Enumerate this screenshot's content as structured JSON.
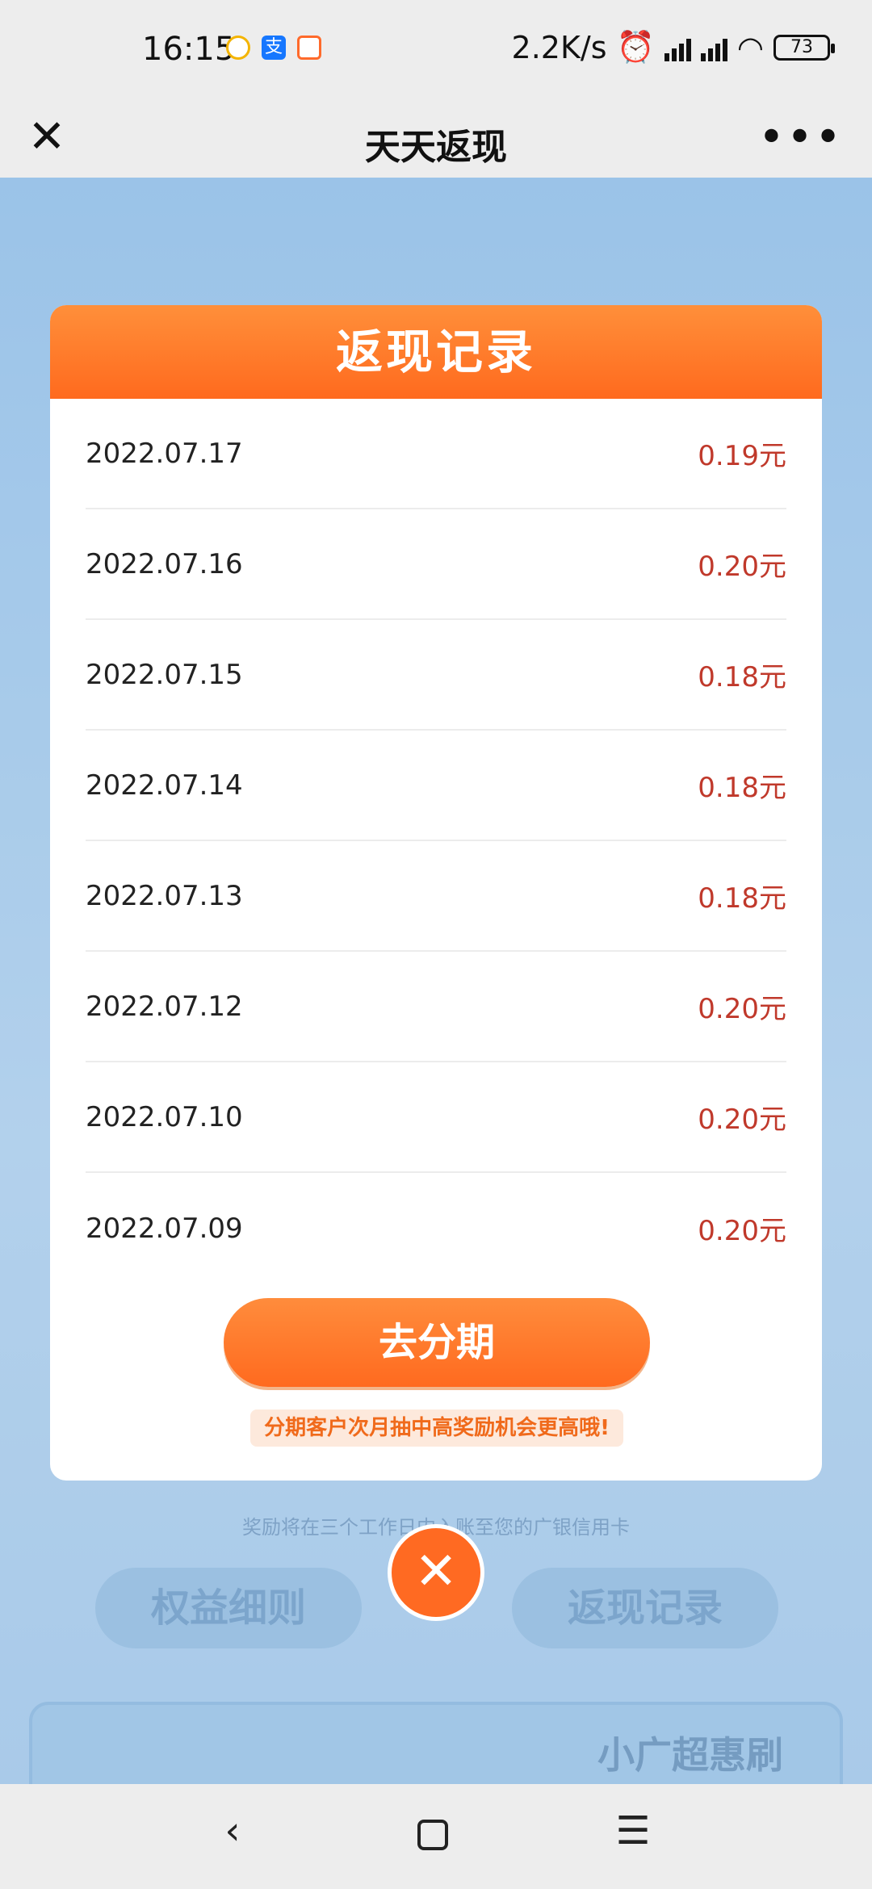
{
  "status_bar": {
    "time": "16:15",
    "network_speed": "2.2K/s",
    "battery": "73"
  },
  "nav": {
    "title": "天天返现",
    "close_icon": "close-icon",
    "more_icon": "more-dots-icon"
  },
  "modal": {
    "title": "返现记录",
    "records": [
      {
        "date": "2022.07.17",
        "amount": "0.19元"
      },
      {
        "date": "2022.07.16",
        "amount": "0.20元"
      },
      {
        "date": "2022.07.15",
        "amount": "0.18元"
      },
      {
        "date": "2022.07.14",
        "amount": "0.18元"
      },
      {
        "date": "2022.07.13",
        "amount": "0.18元"
      },
      {
        "date": "2022.07.12",
        "amount": "0.20元"
      },
      {
        "date": "2022.07.10",
        "amount": "0.20元"
      },
      {
        "date": "2022.07.09",
        "amount": "0.20元"
      }
    ],
    "cta_label": "去分期",
    "cta_note": "分期客户次月抽中高奖励机会更高哦!"
  },
  "background": {
    "hint": "奖励将在三个工作日内入账至您的广银信用卡",
    "left_button": "权益细则",
    "right_button": "返现记录",
    "card_title": "小广超惠刷"
  },
  "colors": {
    "accent": "#ff6a1e",
    "amount": "#c0392b"
  }
}
